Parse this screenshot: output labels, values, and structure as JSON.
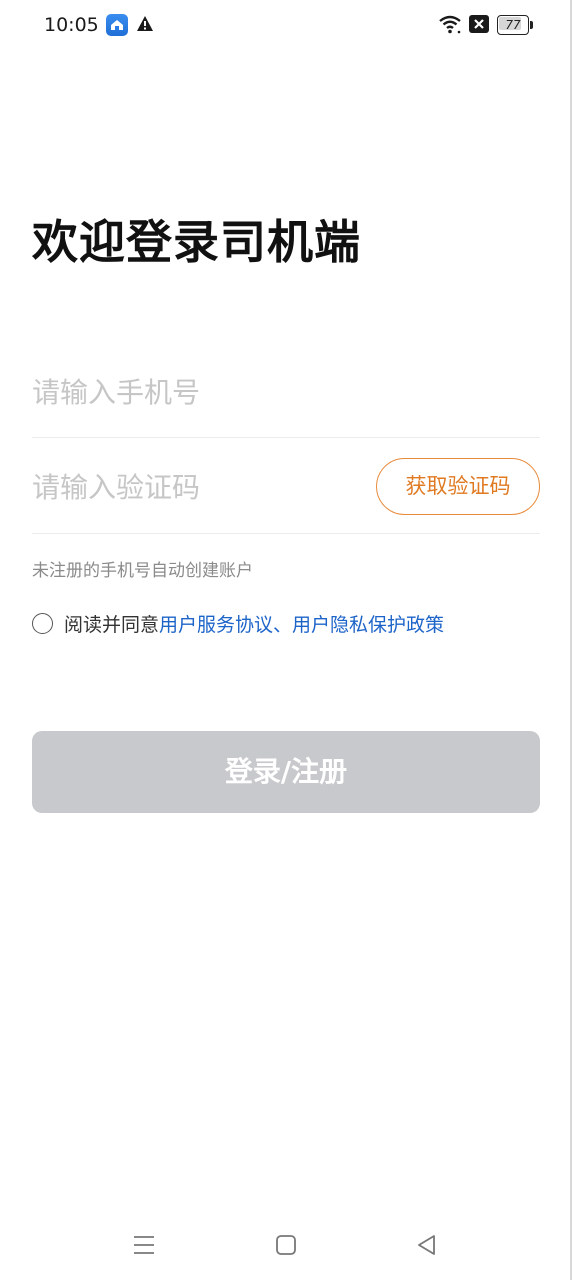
{
  "status_bar": {
    "time": "10:05",
    "battery_level": "77",
    "battery_fraction": 0.77,
    "icons": [
      "app-notification-icon",
      "warning-icon",
      "wifi-icon",
      "close-box-icon",
      "battery-icon"
    ]
  },
  "login": {
    "title": "欢迎登录司机端",
    "phone_placeholder": "请输入手机号",
    "phone_value": "",
    "code_placeholder": "请输入验证码",
    "code_value": "",
    "get_code_label": "获取验证码",
    "hint": "未注册的手机号自动创建账户",
    "agreement": {
      "checked": false,
      "prefix": "阅读并同意",
      "link1": "用户服务协议",
      "separator": "、",
      "link2": "用户隐私保护政策"
    },
    "submit_label": "登录/注册"
  },
  "nav_bar": {
    "icons": [
      "menu-icon",
      "home-icon",
      "back-icon"
    ]
  },
  "colors": {
    "accent_orange": "#e07a22",
    "link_blue": "#1d64c9",
    "disabled_button": "#c8c9cc",
    "placeholder": "#c6c6c6"
  }
}
